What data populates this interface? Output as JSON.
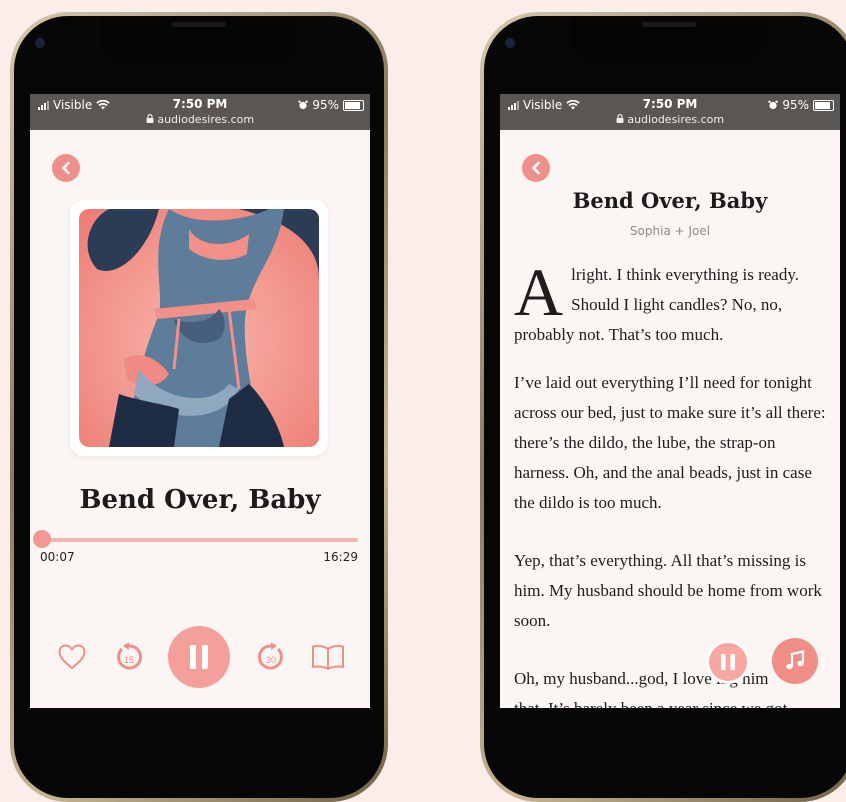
{
  "status": {
    "carrier": "Visible",
    "time": "7:50 PM",
    "battery": "95%",
    "url": "audiodesires.com"
  },
  "player": {
    "title": "Bend Over, Baby",
    "elapsed": "00:07",
    "total": "16:29",
    "progress_fraction": 0.007,
    "skip_back": "15",
    "skip_forward": "30"
  },
  "reader": {
    "title": "Bend Over, Baby",
    "subtitle": "Sophia + Joel",
    "dropcap": "A",
    "paragraphs": [
      "lright. I think everything is ready. Should I light candles? No, no, probably not. That’s too much.",
      "I’ve laid out everything I’ll need for tonight across our bed, just to make sure it’s all there: there’s the dildo, the lube, the strap-on harness. Oh, and the anal beads, just in case the dildo is too much.",
      "Yep, that’s everything. All that’s missing is him. My husband should be home from work soon.",
      "Oh, my husband...god, I love"
    ],
    "para4_tail": "ing him",
    "para5": "that. It’s barely been a year since we got"
  },
  "colors": {
    "accent": "#ef8f89",
    "accent_light": "#f4a09a",
    "background": "#fbeeea"
  },
  "icons": [
    "chevron-left-icon",
    "heart-icon",
    "rewind-15-icon",
    "pause-icon",
    "forward-30-icon",
    "book-icon",
    "music-note-icon",
    "wifi-icon",
    "alarm-icon",
    "lock-icon"
  ]
}
